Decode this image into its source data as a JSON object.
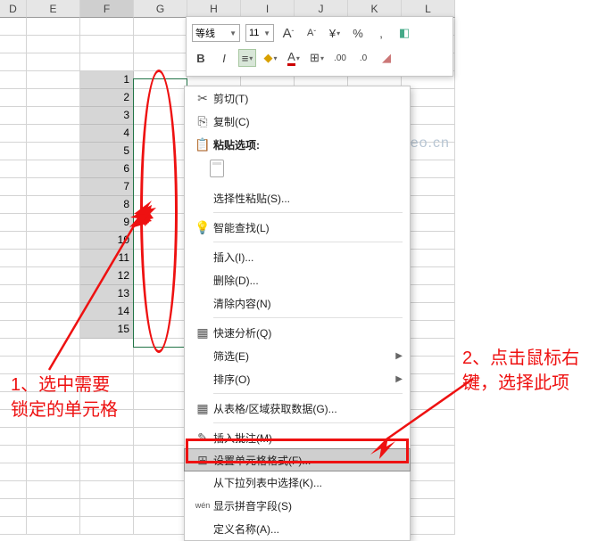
{
  "columns": [
    "D",
    "E",
    "F",
    "G",
    "H",
    "I",
    "J",
    "K",
    "L"
  ],
  "col_f_values": [
    "1",
    "2",
    "3",
    "4",
    "5",
    "6",
    "7",
    "8",
    "9",
    "10",
    "11",
    "12",
    "13",
    "14",
    "15"
  ],
  "row_count": 29,
  "minitoolbar": {
    "font_name": "等线",
    "font_size": "11",
    "grow": "A",
    "shrink": "A",
    "percent": "%",
    "comma": ",",
    "bold": "B",
    "italic": "I"
  },
  "context_menu": {
    "cut": "剪切(T)",
    "copy": "复制(C)",
    "paste_options": "粘贴选项:",
    "paste_special": "选择性粘贴(S)...",
    "smart_lookup": "智能查找(L)",
    "insert": "插入(I)...",
    "delete": "删除(D)...",
    "clear": "清除内容(N)",
    "quick_analysis": "快速分析(Q)",
    "filter": "筛选(E)",
    "sort": "排序(O)",
    "get_from_range": "从表格/区域获取数据(G)...",
    "insert_comment": "插入批注(M)",
    "format_cells": "设置单元格格式(F)...",
    "pick_from_list": "从下拉列表中选择(K)...",
    "phonetic": "显示拼音字段(S)",
    "define_name": "定义名称(A)..."
  },
  "watermark": "passneo.cn",
  "annotation1_line1": "1、选中需要",
  "annotation1_line2": "锁定的单元格",
  "annotation2_line1": "2、点击鼠标右",
  "annotation2_line2": "键，选择此项"
}
